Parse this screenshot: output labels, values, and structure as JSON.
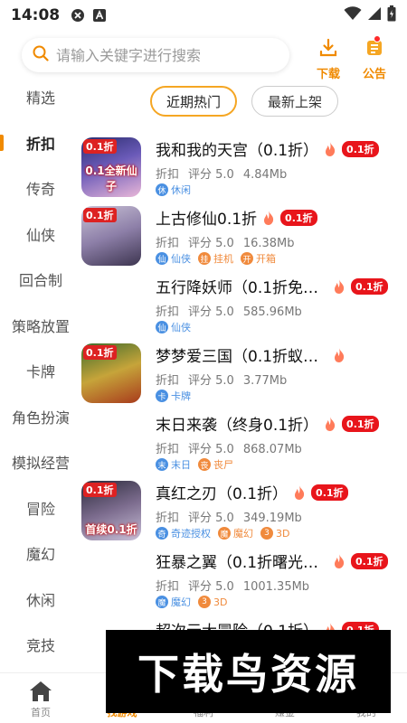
{
  "status_bar": {
    "time": "14:08"
  },
  "search": {
    "placeholder": "请输入关键字进行搜索"
  },
  "header_actions": {
    "download_label": "下载",
    "notice_label": "公告"
  },
  "sidebar": {
    "items": [
      {
        "label": "精选",
        "active": false
      },
      {
        "label": "折扣",
        "active": true
      },
      {
        "label": "传奇",
        "active": false
      },
      {
        "label": "仙侠",
        "active": false
      },
      {
        "label": "回合制",
        "active": false
      },
      {
        "label": "策略放置",
        "active": false
      },
      {
        "label": "卡牌",
        "active": false
      },
      {
        "label": "角色扮演",
        "active": false
      },
      {
        "label": "模拟经营",
        "active": false
      },
      {
        "label": "冒险",
        "active": false
      },
      {
        "label": "魔幻",
        "active": false
      },
      {
        "label": "休闲",
        "active": false
      },
      {
        "label": "竞技",
        "active": false
      }
    ]
  },
  "filter_tabs": {
    "hot": "近期热门",
    "new": "最新上架"
  },
  "games": [
    {
      "name": "我和我的天宫（0.1折）",
      "discount": "0.1折",
      "type": "折扣",
      "rating": "评分 5.0",
      "size": "4.84Mb",
      "tags": [
        {
          "icon": "休",
          "label": "休闲",
          "color": "#4a90e2"
        }
      ],
      "has_icon": true,
      "icon_badge": "0.1折",
      "icon_banner": "0.1全新仙子"
    },
    {
      "name": "上古修仙0.1折",
      "discount": "0.1折",
      "type": "折扣",
      "rating": "评分 5.0",
      "size": "16.38Mb",
      "tags": [
        {
          "icon": "仙",
          "label": "仙侠",
          "color": "#4a90e2"
        },
        {
          "icon": "挂",
          "label": "挂机",
          "color": "#f08a3c"
        },
        {
          "icon": "开",
          "label": "开箱",
          "color": "#f08a3c"
        }
      ],
      "has_icon": true,
      "icon_badge": "0.1折",
      "icon_banner": ""
    },
    {
      "name": "五行降妖师（0.1折免费…",
      "discount": "0.1折",
      "type": "折扣",
      "rating": "评分 5.0",
      "size": "585.96Mb",
      "tags": [
        {
          "icon": "仙",
          "label": "仙侠",
          "color": "#4a90e2"
        }
      ],
      "has_icon": false,
      "icon_badge": "",
      "icon_banner": ""
    },
    {
      "name": "梦梦爱三国（0.1折蚁国…",
      "discount": "",
      "type": "折扣",
      "rating": "评分 5.0",
      "size": "3.77Mb",
      "tags": [
        {
          "icon": "卡",
          "label": "卡牌",
          "color": "#4a90e2"
        }
      ],
      "has_icon": true,
      "icon_badge": "0.1折",
      "icon_banner": ""
    },
    {
      "name": "末日来袭（终身0.1折）",
      "discount": "0.1折",
      "type": "折扣",
      "rating": "评分 5.0",
      "size": "868.07Mb",
      "tags": [
        {
          "icon": "末",
          "label": "末日",
          "color": "#4a90e2"
        },
        {
          "icon": "丧",
          "label": "丧尸",
          "color": "#f08a3c"
        }
      ],
      "has_icon": false,
      "icon_badge": "",
      "icon_banner": ""
    },
    {
      "name": "真红之刃（0.1折）",
      "discount": "0.1折",
      "type": "折扣",
      "rating": "评分 5.0",
      "size": "349.19Mb",
      "tags": [
        {
          "icon": "奇",
          "label": "奇迹授权",
          "color": "#4a90e2"
        },
        {
          "icon": "魔",
          "label": "魔幻",
          "color": "#f08a3c"
        },
        {
          "icon": "3",
          "label": "3D",
          "color": "#f08a3c"
        }
      ],
      "has_icon": true,
      "icon_badge": "0.1折",
      "icon_banner": "首续0.1折"
    },
    {
      "name": "狂暴之翼（0.1折曙光之…",
      "discount": "0.1折",
      "type": "折扣",
      "rating": "评分 5.0",
      "size": "1001.35Mb",
      "tags": [
        {
          "icon": "魔",
          "label": "魔幻",
          "color": "#4a90e2"
        },
        {
          "icon": "3",
          "label": "3D",
          "color": "#f08a3c"
        }
      ],
      "has_icon": false,
      "icon_badge": "",
      "icon_banner": ""
    },
    {
      "name": "超次元大冒险（0.1折）",
      "discount": "0.1折",
      "type": "",
      "rating": "",
      "size": "",
      "tags": [],
      "has_icon": false,
      "icon_badge": "",
      "icon_banner": ""
    }
  ],
  "bottom_nav": [
    {
      "label": "首页",
      "active": false
    },
    {
      "label": "找游戏",
      "active": true
    },
    {
      "label": "福利",
      "active": false
    },
    {
      "label": "赚金",
      "active": false
    },
    {
      "label": "我的",
      "active": false
    }
  ],
  "watermark": "下载鸟资源",
  "colors": {
    "accent": "#f08a00",
    "discount_red": "#e8151b",
    "tag_blue": "#4a90e2",
    "tag_orange": "#f08a3c"
  }
}
